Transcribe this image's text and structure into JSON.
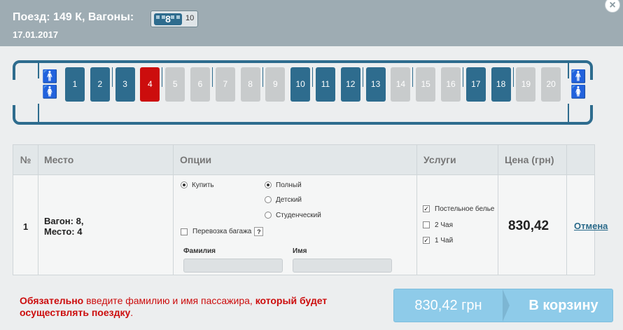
{
  "header": {
    "title": "Поезд: 149 К, Вагоны:",
    "selected_wagon": "8",
    "wagon_count": "10",
    "date": "17.01.2017",
    "close": "×"
  },
  "train": {
    "cars": [
      {
        "label": "1",
        "status": "available"
      },
      {
        "label": "2",
        "status": "available"
      },
      {
        "label": "3",
        "status": "available"
      },
      {
        "label": "4",
        "status": "selected"
      },
      {
        "label": "5",
        "status": "occupied"
      },
      {
        "label": "6",
        "status": "occupied"
      },
      {
        "label": "7",
        "status": "occupied"
      },
      {
        "label": "8",
        "status": "occupied"
      },
      {
        "label": "9",
        "status": "occupied"
      },
      {
        "label": "10",
        "status": "available"
      },
      {
        "label": "11",
        "status": "available"
      },
      {
        "label": "12",
        "status": "available"
      },
      {
        "label": "13",
        "status": "available"
      },
      {
        "label": "14",
        "status": "occupied"
      },
      {
        "label": "15",
        "status": "occupied"
      },
      {
        "label": "16",
        "status": "occupied"
      },
      {
        "label": "17",
        "status": "available"
      },
      {
        "label": "18",
        "status": "available"
      },
      {
        "label": "19",
        "status": "occupied"
      },
      {
        "label": "20",
        "status": "occupied"
      }
    ],
    "wc_icon": "toilet-icon"
  },
  "table": {
    "headers": {
      "num": "№",
      "place": "Место",
      "options": "Опции",
      "services": "Услуги",
      "price": "Цена (грн)"
    },
    "row": {
      "num": "1",
      "place_line1": "Вагон: 8,",
      "place_line2": "Место: 4",
      "buy": "Купить",
      "fare_full": "Полный",
      "fare_child": "Детский",
      "fare_student": "Студенческий",
      "luggage": "Перевозка багажа",
      "luggage_help": "?",
      "surname_label": "Фамилия",
      "surname_value": "",
      "name_label": "Имя",
      "name_value": "",
      "service_linen": "Постельное белье",
      "service_tea2": "2 Чая",
      "service_tea1": "1 Чай",
      "price": "830,42",
      "cancel": "Отмена"
    },
    "checked": {
      "buy": true,
      "fare": "full",
      "luggage": false,
      "linen": true,
      "tea2": false,
      "tea1": true
    }
  },
  "footer": {
    "note_bold1": "Обязательно",
    "note_mid": " введите фамилию и имя пассажира, ",
    "note_bold2": "который будет осуществлять поездку",
    "note_end": ".",
    "basket_price": "830,42 грн",
    "basket_label": "В корзину"
  },
  "colors": {
    "accent": "#2e6c8e",
    "selected": "#cc0d0d",
    "occupied": "#c8cbcc",
    "header_bg": "#9eacb3",
    "button": "#8ecbe9"
  }
}
